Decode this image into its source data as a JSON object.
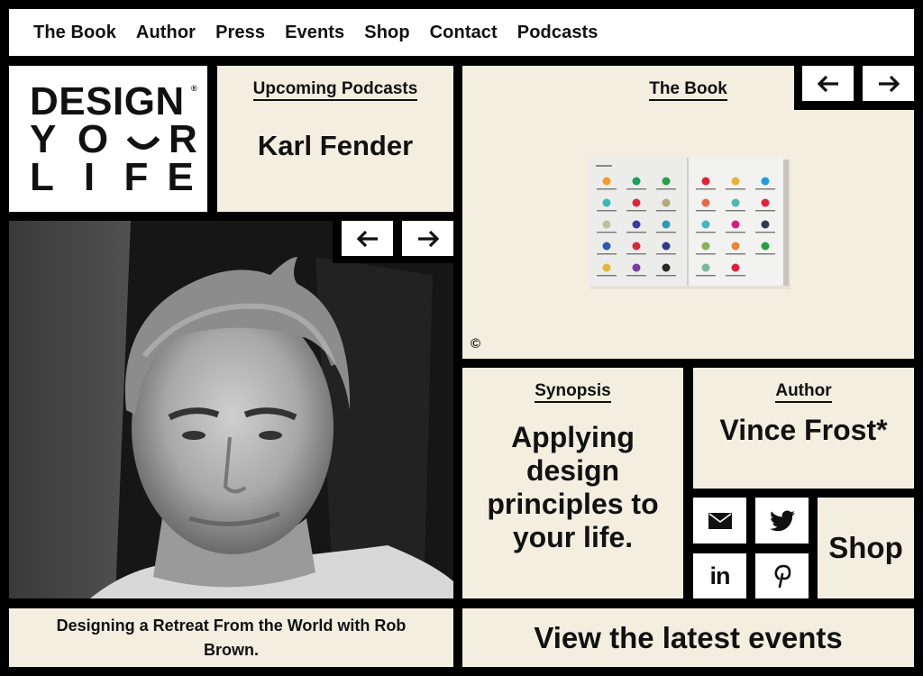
{
  "nav": {
    "items": [
      "The Book",
      "Author",
      "Press",
      "Events",
      "Shop",
      "Contact",
      "Podcasts"
    ]
  },
  "logo": {
    "line1": "DESIGN",
    "line2": [
      "Y",
      "O",
      "U",
      "R"
    ],
    "line3": [
      "L",
      "I",
      "F",
      "E"
    ],
    "registered": "®"
  },
  "podcasts": {
    "heading": "Upcoming Podcasts",
    "name": "Karl Fender"
  },
  "photo": {
    "alt": "Black and white portrait of a man",
    "prev_icon": "arrow-left-icon",
    "next_icon": "arrow-right-icon"
  },
  "book": {
    "heading": "The Book",
    "copyright": "©",
    "prev_icon": "arrow-left-icon",
    "next_icon": "arrow-right-icon",
    "dot_colors": [
      [
        "#f39a2c",
        "#1ea05a",
        "#2a9e46",
        "#d7263a",
        "#e6b43c",
        "#2a9ad6"
      ],
      [
        "#3ab8b8",
        "#d42b3a",
        "#b8a87a",
        "#e66a4a",
        "#4cb8b0",
        "#d7263a"
      ],
      [
        "#b8c0a0",
        "#3b3aa0",
        "#2a9ab8",
        "#40b8c0",
        "#d4207a",
        "#2e3a4a"
      ],
      [
        "#2a5ab0",
        "#d42b3a",
        "#2e3a8a",
        "#8ab05a",
        "#e6843a",
        "#2a9e46"
      ],
      [
        "#e6b43c",
        "#7a3aa0",
        "#2a2a20",
        "#7ab8a0",
        "#d7263a",
        ""
      ]
    ]
  },
  "synopsis": {
    "heading": "Synopsis",
    "text": "Applying design principles to your life."
  },
  "author": {
    "heading": "Author",
    "name": "Vince Frost*"
  },
  "social": {
    "icons": [
      "mail-icon",
      "twitter-icon",
      "linkedin-icon",
      "pinterest-icon"
    ]
  },
  "shop": {
    "label": "Shop"
  },
  "caption": {
    "text": "Designing a Retreat From the World with Rob Brown."
  },
  "events": {
    "label": "View the latest events"
  }
}
